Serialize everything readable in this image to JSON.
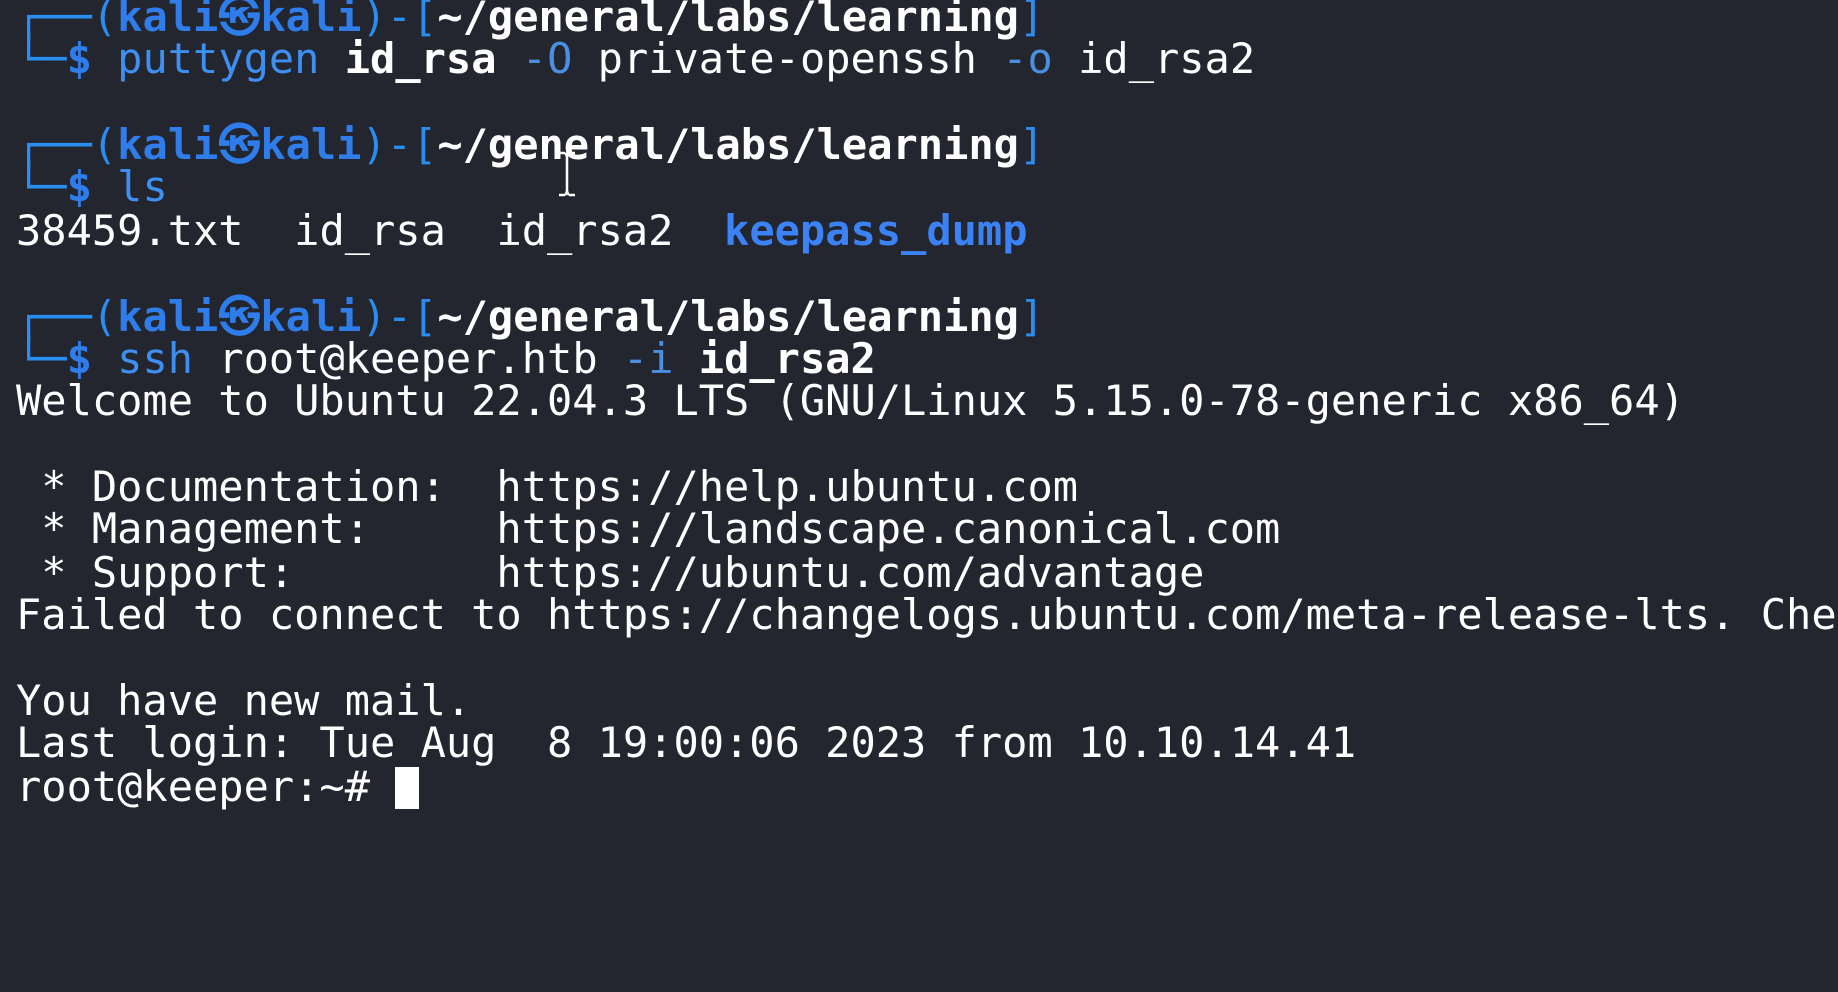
{
  "prompts": [
    {
      "user": "kali",
      "at": "㉿",
      "host": "kali",
      "path": "~/general/labs/learning"
    },
    {
      "user": "kali",
      "at": "㉿",
      "host": "kali",
      "path": "~/general/labs/learning"
    },
    {
      "user": "kali",
      "at": "㉿",
      "host": "kali",
      "path": "~/general/labs/learning"
    }
  ],
  "commands": [
    {
      "dollar": "$",
      "cmd": "puttygen",
      "arg1": "id_rsa",
      "opt1": "-O",
      "arg2": "private-openssh",
      "opt2": "-o",
      "arg3": "id_rsa2"
    },
    {
      "dollar": "$",
      "cmd": "ls"
    },
    {
      "dollar": "$",
      "cmd": "ssh",
      "arg1": "root@keeper.htb",
      "opt1": "-i",
      "arg2": "id_rsa2"
    }
  ],
  "ls_output": {
    "files": [
      "38459.txt",
      "id_rsa",
      "id_rsa2"
    ],
    "dir": "keepass_dump"
  },
  "ssh_output": {
    "welcome": "Welcome to Ubuntu 22.04.3 LTS (GNU/Linux 5.15.0-78-generic x86_64)",
    "doc": " * Documentation:  https://help.ubuntu.com",
    "mgmt": " * Management:     https://landscape.canonical.com",
    "support": " * Support:        https://ubuntu.com/advantage",
    "failed": "Failed to connect to https://changelogs.ubuntu.com/meta-release-lts. Check yo",
    "mail": "You have new mail.",
    "last_login": "Last login: Tue Aug  8 19:00:06 2023 from 10.10.14.41",
    "root_prompt": "root@keeper:~# "
  },
  "colors": {
    "background": "#23252f",
    "prompt_blue": "#2f7dea",
    "dir_blue": "#3b82f6"
  }
}
